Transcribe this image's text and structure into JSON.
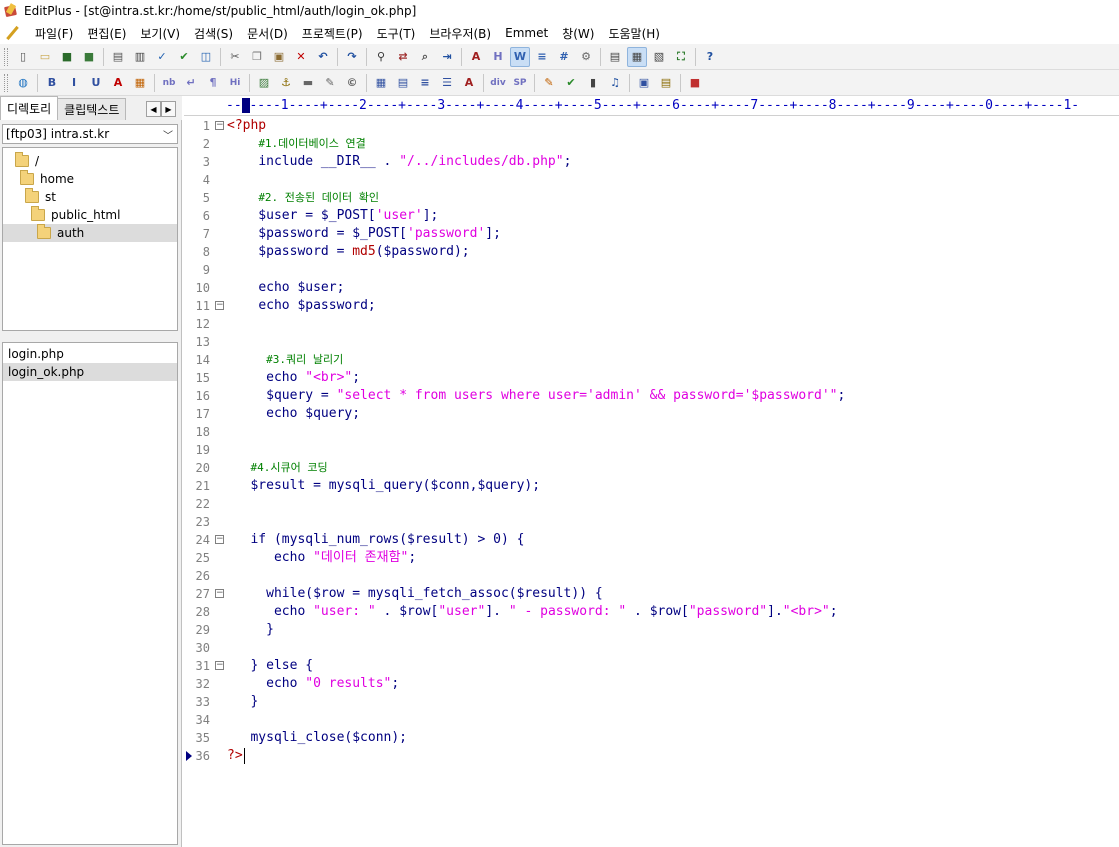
{
  "window": {
    "title": "EditPlus - [st@intra.st.kr:/home/st/public_html/auth/login_ok.php]"
  },
  "menu": {
    "items": [
      "파일(F)",
      "편집(E)",
      "보기(V)",
      "검색(S)",
      "문서(D)",
      "프로젝트(P)",
      "도구(T)",
      "브라우저(B)",
      "Emmet",
      "창(W)",
      "도움말(H)"
    ]
  },
  "toolbar1": {
    "icons": [
      "new-file-icon",
      "open-folder-icon",
      "save-icon",
      "save-all-icon",
      "print-preview-icon",
      "print-icon",
      "spell-check-icon",
      "check-icon",
      "browser-icon",
      "cut-icon",
      "copy-icon",
      "paste-icon",
      "delete-icon",
      "undo-icon",
      "redo-icon",
      "find-icon",
      "replace-icon",
      "find-in-files-icon",
      "goto-line-icon",
      "font-icon",
      "hex-icon",
      "word-wrap-icon",
      "line-wrap-icon",
      "line-number-icon",
      "settings-icon",
      "output-window-icon",
      "directory-window-icon",
      "cliptext-window-icon",
      "fullscreen-icon",
      "help-icon"
    ]
  },
  "toolbar2": {
    "icons": [
      "globe-icon",
      "bold-icon",
      "italic-icon",
      "underline-icon",
      "font-color-icon",
      "color-picker-icon",
      "nbsp-icon",
      "break-icon",
      "paragraph-icon",
      "heading-icon",
      "image-icon",
      "anchor-icon",
      "hr-icon",
      "comment-icon",
      "entity-icon",
      "table-icon",
      "form-icon",
      "center-icon",
      "list-icon",
      "font-tag-icon",
      "div-icon",
      "span-icon",
      "edit-icon",
      "check-icon",
      "media-icon",
      "music-icon",
      "frame-icon",
      "layer-icon",
      "color-icon"
    ]
  },
  "sidebar": {
    "tabs": [
      "디렉토리",
      "클립텍스트"
    ],
    "arrows": [
      "◀",
      "▶"
    ],
    "site": "[ftp03] intra.st.kr",
    "tree": [
      "/",
      "home",
      "st",
      "public_html",
      "auth"
    ],
    "files": [
      "login.php",
      "login_ok.php"
    ]
  },
  "editor": {
    "ruler": "--+----1----+----2----+----3----+----4----+----5----+----6----+----7----+----8----+----9----+----0----+----1-",
    "lines": [
      {
        "n": "1",
        "html": "<span class='c-tag'>&lt;?php</span>"
      },
      {
        "n": "2",
        "html": "    <span class='c-comment'>#1.데이터베이스 연결</span>"
      },
      {
        "n": "3",
        "html": "    <span class='c-kw'>include</span> __DIR__ . <span class='c-str'>\"/../includes/db.php\"</span>;"
      },
      {
        "n": "4",
        "html": ""
      },
      {
        "n": "5",
        "html": "    <span class='c-comment'>#2. 전송된 데이터 확인</span>"
      },
      {
        "n": "6",
        "html": "    $user = $_POST[<span class='c-str'>'user'</span>];"
      },
      {
        "n": "7",
        "html": "    $password = $_POST[<span class='c-str'>'password'</span>];"
      },
      {
        "n": "8",
        "html": "    $password = <span class='c-fn'>md5</span>($password);"
      },
      {
        "n": "9",
        "html": ""
      },
      {
        "n": "10",
        "html": "    <span class='c-kw'>echo</span> $user;"
      },
      {
        "n": "11",
        "html": "    <span class='c-kw'>echo</span> $password;"
      },
      {
        "n": "12",
        "html": ""
      },
      {
        "n": "13",
        "html": ""
      },
      {
        "n": "14",
        "html": "     <span class='c-comment'>#3.쿼리 날리기</span>"
      },
      {
        "n": "15",
        "html": "     <span class='c-kw'>echo</span> <span class='c-str'>\"&lt;br&gt;\"</span>;"
      },
      {
        "n": "16",
        "html": "     $query = <span class='c-str'>\"select * from users where user='admin' &amp;&amp; password='$password'\"</span>;"
      },
      {
        "n": "17",
        "html": "     <span class='c-kw'>echo</span> $query;"
      },
      {
        "n": "18",
        "html": ""
      },
      {
        "n": "19",
        "html": ""
      },
      {
        "n": "20",
        "html": "   <span class='c-comment'>#4.시큐어 코딩</span>"
      },
      {
        "n": "21",
        "html": "   $result = mysqli_query($conn,$query);"
      },
      {
        "n": "22",
        "html": ""
      },
      {
        "n": "23",
        "html": ""
      },
      {
        "n": "24",
        "html": "   <span class='c-kw'>if</span> (mysqli_num_rows($result) &gt; 0) {"
      },
      {
        "n": "25",
        "html": "      <span class='c-kw'>echo</span> <span class='c-str'>\"데이터 존재함\"</span>;"
      },
      {
        "n": "26",
        "html": ""
      },
      {
        "n": "27",
        "html": "     <span class='c-kw'>while</span>($row = mysqli_fetch_assoc($result)) {"
      },
      {
        "n": "28",
        "html": "      <span class='c-kw'>echo</span> <span class='c-str'>\"user: \"</span> . $row[<span class='c-str'>\"user\"</span>]. <span class='c-str'>\" - password: \"</span> . $row[<span class='c-str'>\"password\"</span>].<span class='c-str'>\"&lt;br&gt;\"</span>;"
      },
      {
        "n": "29",
        "html": "     }"
      },
      {
        "n": "30",
        "html": ""
      },
      {
        "n": "31",
        "html": "   } <span class='c-kw'>else</span> {"
      },
      {
        "n": "32",
        "html": "     <span class='c-kw'>echo</span> <span class='c-str'>\"0 results\"</span>;"
      },
      {
        "n": "33",
        "html": "   }"
      },
      {
        "n": "34",
        "html": ""
      },
      {
        "n": "35",
        "html": "   mysqli_close($conn);"
      },
      {
        "n": "36",
        "html": "<span class='c-tag'>?&gt;</span>"
      }
    ],
    "fold_lines": [
      "1",
      "11",
      "24",
      "27",
      "31"
    ],
    "current_line": "36"
  },
  "colors": {
    "tag": "#b00000",
    "comment": "#008000",
    "string": "#e000e0",
    "text": "#000080"
  }
}
